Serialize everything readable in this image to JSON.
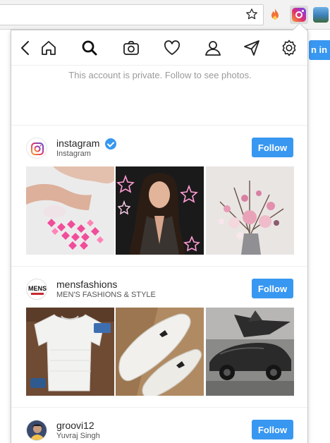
{
  "browser": {
    "icons": [
      "star-icon",
      "extension-fire-icon",
      "extension-instagram-icon",
      "extension-photo-icon"
    ],
    "background_button_label": "n in"
  },
  "popup": {
    "nav_icons": [
      "back-icon",
      "home-icon",
      "search-icon",
      "camera-icon",
      "heart-icon",
      "profile-icon",
      "direct-icon",
      "settings-icon"
    ],
    "private_message": "This account is private. Follow to see photos."
  },
  "suggestions": [
    {
      "username": "instagram",
      "full_name": "Instagram",
      "verified": true,
      "follow_label": "Follow"
    },
    {
      "username": "mensfashions",
      "full_name": "MEN'S FASHIONS & STYLE",
      "verified": false,
      "follow_label": "Follow",
      "avatar_text": "MENS"
    },
    {
      "username": "groovi12",
      "full_name": "Yuvraj Singh",
      "verified": false,
      "follow_label": "Follow"
    }
  ],
  "colors": {
    "accent": "#3897f0",
    "text": "#262626",
    "muted": "#9a9a9a"
  }
}
